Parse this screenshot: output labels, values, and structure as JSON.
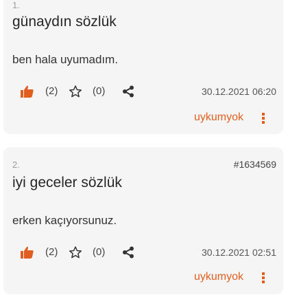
{
  "entries": [
    {
      "number": "1.",
      "id": "",
      "title": "günaydın sözlük",
      "body": "ben hala uyumadım.",
      "likes": "(2)",
      "favorites": "(0)",
      "date": "30.12.2021 06:20",
      "author": "uykumyok"
    },
    {
      "number": "2.",
      "id": "#1634569",
      "title": "iyi geceler sözlük",
      "body": "erken kaçıyorsunuz.",
      "likes": "(2)",
      "favorites": "(0)",
      "date": "30.12.2021 02:51",
      "author": "uykumyok"
    }
  ],
  "icons": {
    "like": "thumbs-up-icon",
    "favorite": "star-outline-icon",
    "share": "share-icon",
    "more": "more-vertical-icon"
  },
  "colors": {
    "accent": "#e05e1f",
    "card_bg": "#f5f5f5",
    "text": "#262626",
    "muted": "#9a9a9a"
  }
}
